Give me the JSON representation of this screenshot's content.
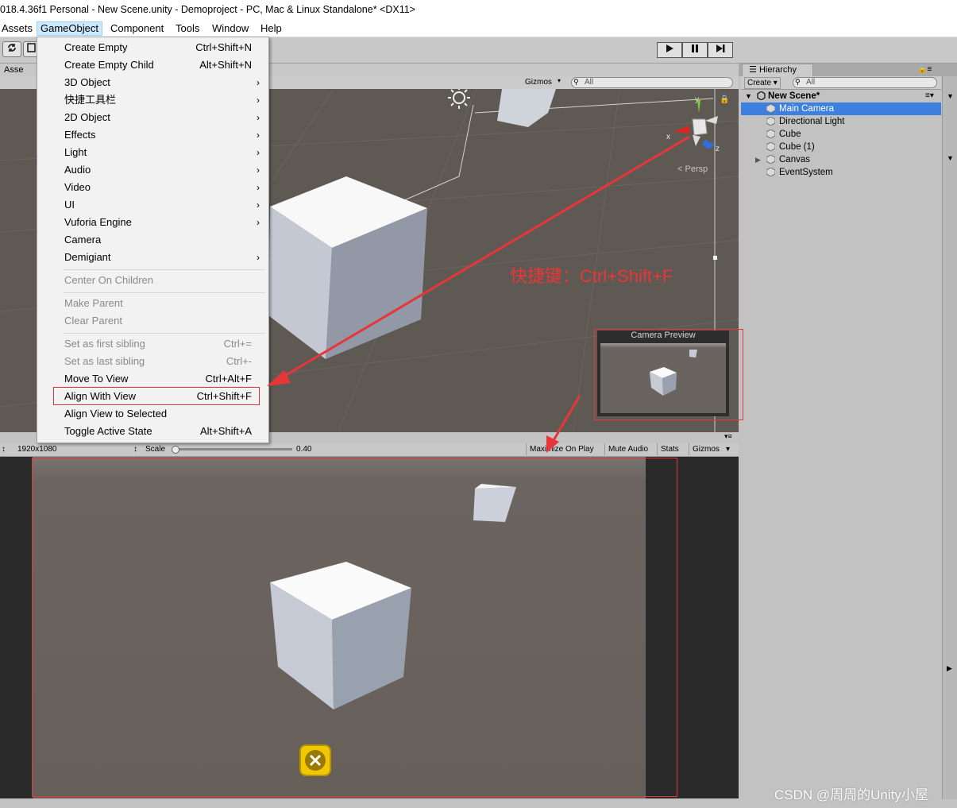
{
  "window": {
    "title": "018.4.36f1 Personal - New Scene.unity - Demoproject - PC, Mac & Linux Standalone* <DX11>"
  },
  "menubar": {
    "items": [
      "Assets",
      "GameObject",
      "Component",
      "Tools",
      "Window",
      "Help"
    ],
    "active": "GameObject"
  },
  "toolbar": {
    "assets_tab": "Asse",
    "play_icon": "play-icon",
    "pause_icon": "pause-icon",
    "step_icon": "step-icon"
  },
  "scene": {
    "gizmos_label": "Gizmos",
    "search_placeholder": "All",
    "persp_label": "Persp",
    "axis_labels": {
      "x": "x",
      "y": "y",
      "z": "z"
    }
  },
  "dropdown": {
    "items": [
      {
        "label": "Create Empty",
        "shortcut": "Ctrl+Shift+N"
      },
      {
        "label": "Create Empty Child",
        "shortcut": "Alt+Shift+N"
      },
      {
        "label": "3D Object",
        "submenu": "›"
      },
      {
        "label": "快捷工具栏",
        "submenu": "›"
      },
      {
        "label": "2D Object",
        "submenu": "›"
      },
      {
        "label": "Effects",
        "submenu": "›"
      },
      {
        "label": "Light",
        "submenu": "›"
      },
      {
        "label": "Audio",
        "submenu": "›"
      },
      {
        "label": "Video",
        "submenu": "›"
      },
      {
        "label": "UI",
        "submenu": "›"
      },
      {
        "label": "Vuforia Engine",
        "submenu": "›"
      },
      {
        "label": "Camera"
      },
      {
        "label": "Demigiant",
        "submenu": "›"
      },
      {
        "label": "Center On Children",
        "disabled": true
      },
      {
        "label": "Make Parent",
        "disabled": true
      },
      {
        "label": "Clear Parent",
        "disabled": true
      },
      {
        "label": "Set as first sibling",
        "shortcut": "Ctrl+=",
        "disabled": true
      },
      {
        "label": "Set as last sibling",
        "shortcut": "Ctrl+-",
        "disabled": true
      },
      {
        "label": "Move To View",
        "shortcut": "Ctrl+Alt+F"
      },
      {
        "label": "Align With View",
        "shortcut": "Ctrl+Shift+F"
      },
      {
        "label": "Align View to Selected"
      },
      {
        "label": "Toggle Active State",
        "shortcut": "Alt+Shift+A"
      }
    ]
  },
  "annotation": {
    "hotkey_text": "快捷键：Ctrl+Shift+F",
    "highlight_color": "#e8353a"
  },
  "camera_preview": {
    "title": "Camera Preview"
  },
  "game_bar": {
    "resolution": "1920x1080",
    "scale_label": "Scale",
    "scale_value": "0.40",
    "scale_fraction": 0.0,
    "maximize_label": "Maximize On Play",
    "mute_label": "Mute Audio",
    "stats_label": "Stats",
    "gizmos_label": "Gizmos"
  },
  "hierarchy": {
    "tab_label": "Hierarchy",
    "create_label": "Create",
    "search_placeholder": "All",
    "scene_name": "New Scene*",
    "items": [
      "Main Camera",
      "Directional Light",
      "Cube",
      "Cube (1)",
      "Canvas",
      "EventSystem"
    ],
    "selected": "Main Camera",
    "selection_color": "#3d80df"
  },
  "watermark": "CSDN @周周的Unity小屋"
}
